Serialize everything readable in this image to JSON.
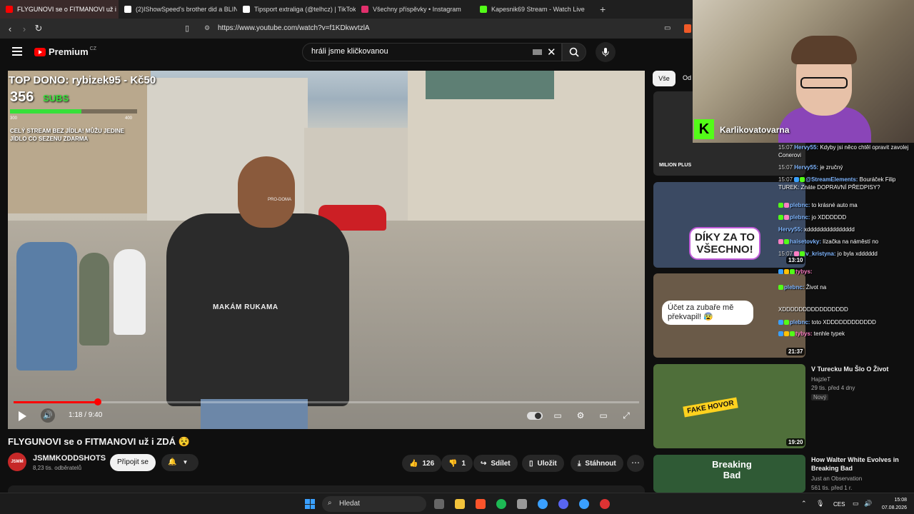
{
  "browser": {
    "tabs": [
      {
        "label": "FLYGUNOVI se o FITMANOVI už i",
        "active": true,
        "icon_color": "#ff0000"
      },
      {
        "label": "(2)IShowSpeed's brother did a BLIND",
        "active": false,
        "icon_color": "#ffffff"
      },
      {
        "label": "Tipsport extraliga (@telhcz) | TikTok",
        "active": false,
        "icon_color": "#ffffff"
      },
      {
        "label": "Všechny příspěvky • Instagram",
        "active": false,
        "icon_color": "#e1306c"
      },
      {
        "label": "Kapesnik69 Stream - Watch Live",
        "active": false,
        "icon_color": "#53fc18"
      }
    ],
    "url": "https://www.youtube.com/watch?v=f1KDkwvtzlA"
  },
  "youtube": {
    "logo_text": "Premium",
    "logo_region": "CZ",
    "search_value": "hráli jsme kličkovanou"
  },
  "video": {
    "overlay_top_donor": "TOP DONO: rybizek95 - Kč50",
    "overlay_subs_count": "356",
    "overlay_subs_label": "SUBS",
    "overlay_subs_goal_min": "300",
    "overlay_subs_goal_max": "400",
    "overlay_subs_progress": 0.56,
    "overlay_notice": "CELÝ STREAM BEZ JÍDLA! MŮŽU JEDINE JÍDLO CO SEZENU ZDARMA",
    "shirt_text": "MAKÁM RUKAMA",
    "shirt_brand": "PRO-DOMA",
    "time_current": "1:18",
    "time_total": "9:40",
    "time_display": "1:18 / 9:40",
    "progress_fraction": 0.135,
    "title": "FLYGUNOVI se o FITMANOVI už i ZDÁ 😵",
    "channel_name": "JSMMKODDSHOTS",
    "channel_subs": "8,23 tis. odběratelů",
    "channel_avatar_text": "JSMM",
    "join_label": "Připojit se",
    "like_count": "126",
    "dislike_count": "1",
    "share_label": "Sdílet",
    "save_label": "Uložit",
    "download_label": "Stáhnout"
  },
  "sidebar": {
    "chip_all": "Vše",
    "chip_next": "Od",
    "items": [
      {
        "title": "",
        "channel": "",
        "meta": "",
        "duration": "",
        "thumb_text": "MILION PLUS",
        "bg": "#2a2a2a"
      },
      {
        "title": "",
        "channel": "",
        "meta": "",
        "duration": "13:10",
        "thumb_text": "DÍKY ZA TO VŠECHNO!",
        "bg": "#3b4a63"
      },
      {
        "title": "",
        "channel": "",
        "meta": "",
        "duration": "21:37",
        "thumb_text": "Účet za zubaře mě překvapil! 😰",
        "bg": "#6a5a48"
      },
      {
        "title": "V Turecku Mu Šlo O Život",
        "channel": "HajzleT",
        "meta": "29 tis.  před 4 dny",
        "badge": "Nový",
        "duration": "19:20",
        "thumb_text": "FAKE HOVOR",
        "bg": "#4f6f3a"
      },
      {
        "title": "How Walter White Evolves in Breaking Bad",
        "channel": "Just an Observation",
        "meta": "561 tis.  před 1 r.",
        "duration": "",
        "thumb_text": "Breaking Bad",
        "bg": "#2f5a35"
      }
    ]
  },
  "stream": {
    "channel_name": "Karlikovatovarna",
    "chat": [
      {
        "ts": "15:07",
        "user": "Hervy55:",
        "text": "Kdyby jsi něco chtěl opravit zavolej Conerovi"
      },
      {
        "ts": "15:07",
        "user": "Hervy55:",
        "text": "je zručný"
      },
      {
        "ts": "15:07",
        "user": "@StreamElements:",
        "text": "Bouráček Filip TUREK: Znáte DOPRAVNÍ PŘEDPISY?"
      },
      {
        "ts": "",
        "user": "plebnc:",
        "text": "to krásné auto ma"
      },
      {
        "ts": "",
        "user": "plebnc:",
        "text": "jo XDDDDDD"
      },
      {
        "ts": "",
        "user": "Hervy55:",
        "text": "xddddddddddddddd"
      },
      {
        "ts": "",
        "user": "haisetovky:",
        "text": "lízačka na náměstí no"
      },
      {
        "ts": "15:07",
        "user": "v_kristyna:",
        "text": "jo byla xdddddd"
      },
      {
        "ts": "",
        "user": "tybys:",
        "text": ""
      },
      {
        "ts": "",
        "user": "plebnc:",
        "text": "Život na"
      },
      {
        "ts": "",
        "user": "",
        "text": "XDDDDDDDDDDDDDDDD"
      },
      {
        "ts": "",
        "user": "plebnc:",
        "text": "toto XDDDDDDDDDDDD"
      },
      {
        "ts": "",
        "user": "tybys:",
        "text": "tenhle typek"
      }
    ]
  },
  "taskbar": {
    "search_placeholder": "Hledat",
    "lang": "CES",
    "time": "15:08",
    "date": "07.08.2026"
  }
}
